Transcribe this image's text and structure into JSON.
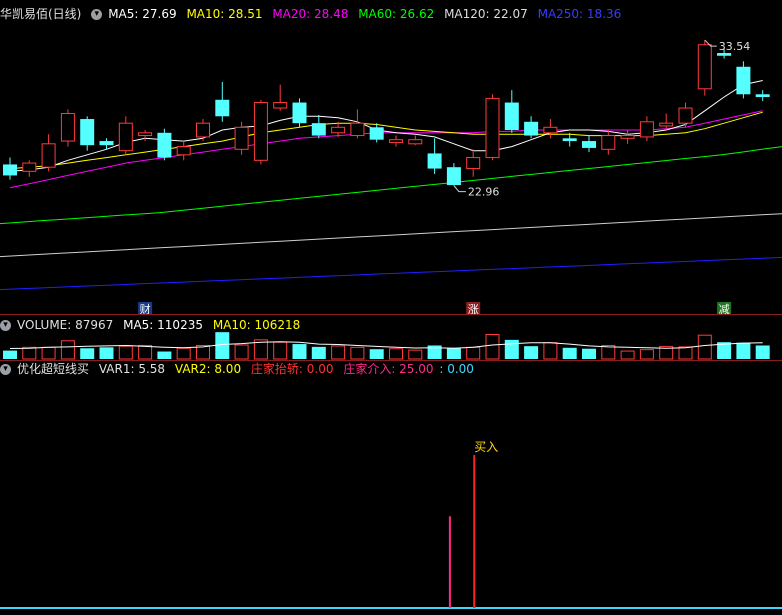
{
  "main_header": {
    "stock": "华凯易佰(日线)",
    "ma5": "MA5: 27.69",
    "ma10": "MA10: 28.51",
    "ma20": "MA20: 28.48",
    "ma60": "MA60: 26.62",
    "ma120": "MA120: 22.07",
    "ma250": "MA250: 18.36"
  },
  "vol_header": {
    "volume": "VOLUME: 87967",
    "ma5": "MA5: 110235",
    "ma10": "MA10: 106218"
  },
  "ind_header": {
    "name": "优化超短线买",
    "var1": "VAR1: 5.58",
    "var2": "VAR2: 8.00",
    "zjcl": "庄家抬轿: 0.00",
    "zjjr": "庄家介入: 25.00",
    "tail": ": 0.00"
  },
  "colors": {
    "up": "#ff3b3b",
    "down": "#54ffff",
    "ma5": "#ffffff",
    "ma10": "#ffff00",
    "ma20": "#ff00ff",
    "ma60": "#00ff00",
    "ma120": "#cfcfcf",
    "ma250": "#2020ff",
    "signal_pink": "#ff2a8a",
    "signal_red": "#ff2020",
    "baseline": "#3fd6ff"
  },
  "chart_data": {
    "type": "candlestick",
    "price_high_label": "33.54",
    "price_low_label": "22.96",
    "markers": [
      {
        "text": "财",
        "candle": 7
      },
      {
        "text": "涨",
        "candle": 24
      },
      {
        "text": "减",
        "candle": 37
      }
    ],
    "buy_label": "买入",
    "candles": [
      {
        "o": 24.5,
        "c": 23.7,
        "h": 25.0,
        "l": 23.4
      },
      {
        "o": 24.0,
        "c": 24.6,
        "h": 24.8,
        "l": 23.6
      },
      {
        "o": 24.3,
        "c": 26.0,
        "h": 26.7,
        "l": 24.0
      },
      {
        "o": 26.2,
        "c": 28.2,
        "h": 28.5,
        "l": 25.8
      },
      {
        "o": 27.8,
        "c": 25.9,
        "h": 28.0,
        "l": 25.5
      },
      {
        "o": 26.2,
        "c": 25.9,
        "h": 26.4,
        "l": 25.6
      },
      {
        "o": 25.5,
        "c": 27.5,
        "h": 28.0,
        "l": 25.2
      },
      {
        "o": 26.6,
        "c": 26.8,
        "h": 27.0,
        "l": 26.2
      },
      {
        "o": 26.8,
        "c": 25.0,
        "h": 27.1,
        "l": 24.8
      },
      {
        "o": 25.2,
        "c": 25.8,
        "h": 26.2,
        "l": 24.8
      },
      {
        "o": 26.5,
        "c": 27.5,
        "h": 27.8,
        "l": 26.2
      },
      {
        "o": 29.2,
        "c": 28.0,
        "h": 30.5,
        "l": 27.6
      },
      {
        "o": 25.6,
        "c": 27.2,
        "h": 27.6,
        "l": 25.2
      },
      {
        "o": 24.8,
        "c": 29.0,
        "h": 29.2,
        "l": 24.5
      },
      {
        "o": 28.6,
        "c": 29.0,
        "h": 30.3,
        "l": 28.4
      },
      {
        "o": 29.0,
        "c": 27.5,
        "h": 29.3,
        "l": 27.2
      },
      {
        "o": 27.5,
        "c": 26.6,
        "h": 28.1,
        "l": 26.4
      },
      {
        "o": 26.8,
        "c": 27.2,
        "h": 27.6,
        "l": 26.5
      },
      {
        "o": 26.6,
        "c": 27.5,
        "h": 28.5,
        "l": 26.4
      },
      {
        "o": 27.2,
        "c": 26.3,
        "h": 27.5,
        "l": 26.1
      },
      {
        "o": 26.1,
        "c": 26.3,
        "h": 26.6,
        "l": 25.8
      },
      {
        "o": 26.0,
        "c": 26.3,
        "h": 26.6,
        "l": 25.9
      },
      {
        "o": 25.3,
        "c": 24.2,
        "h": 26.4,
        "l": 23.8
      },
      {
        "o": 24.3,
        "c": 23.0,
        "h": 24.6,
        "l": 22.96
      },
      {
        "o": 24.2,
        "c": 25.0,
        "h": 25.6,
        "l": 23.6
      },
      {
        "o": 25.0,
        "c": 29.3,
        "h": 29.6,
        "l": 24.8
      },
      {
        "o": 29.0,
        "c": 27.0,
        "h": 29.9,
        "l": 26.8
      },
      {
        "o": 27.6,
        "c": 26.6,
        "h": 28.0,
        "l": 26.4
      },
      {
        "o": 26.8,
        "c": 27.2,
        "h": 27.8,
        "l": 26.4
      },
      {
        "o": 26.4,
        "c": 26.2,
        "h": 26.8,
        "l": 25.8
      },
      {
        "o": 26.2,
        "c": 25.7,
        "h": 26.6,
        "l": 25.4
      },
      {
        "o": 25.6,
        "c": 26.6,
        "h": 27.0,
        "l": 25.2
      },
      {
        "o": 26.4,
        "c": 26.6,
        "h": 27.0,
        "l": 26.0
      },
      {
        "o": 26.5,
        "c": 27.6,
        "h": 28.0,
        "l": 26.2
      },
      {
        "o": 27.3,
        "c": 27.5,
        "h": 28.2,
        "l": 27.0
      },
      {
        "o": 27.5,
        "c": 28.6,
        "h": 29.0,
        "l": 27.2
      },
      {
        "o": 30.0,
        "c": 33.2,
        "h": 33.54,
        "l": 29.5
      },
      {
        "o": 32.6,
        "c": 32.4,
        "h": 32.9,
        "l": 32.2
      },
      {
        "o": 31.6,
        "c": 29.6,
        "h": 32.0,
        "l": 29.3
      },
      {
        "o": 29.6,
        "c": 29.4,
        "h": 29.9,
        "l": 29.1
      }
    ],
    "volumes": [
      0.36,
      0.5,
      0.5,
      0.78,
      0.46,
      0.5,
      0.55,
      0.58,
      0.32,
      0.46,
      0.58,
      1.15,
      0.6,
      0.82,
      0.72,
      0.64,
      0.52,
      0.56,
      0.5,
      0.42,
      0.44,
      0.38,
      0.58,
      0.48,
      0.5,
      1.05,
      0.82,
      0.55,
      0.7,
      0.48,
      0.44,
      0.58,
      0.34,
      0.4,
      0.54,
      0.52,
      1.02,
      0.72,
      0.7,
      0.58
    ],
    "vol_ma5": [
      0.45,
      0.46,
      0.5,
      0.52,
      0.55,
      0.56,
      0.58,
      0.54,
      0.5,
      0.48,
      0.52,
      0.62,
      0.66,
      0.72,
      0.74,
      0.72,
      0.64,
      0.62,
      0.58,
      0.54,
      0.5,
      0.47,
      0.48,
      0.46,
      0.5,
      0.6,
      0.65,
      0.7,
      0.7,
      0.64,
      0.56,
      0.52,
      0.5,
      0.48,
      0.46,
      0.48,
      0.58,
      0.64,
      0.68,
      0.7
    ],
    "ma5": [
      24.0,
      24.1,
      24.3,
      24.8,
      25.2,
      25.6,
      26.1,
      26.4,
      26.3,
      26.2,
      26.4,
      27.0,
      27.2,
      27.3,
      27.7,
      28.0,
      28.0,
      27.9,
      27.6,
      27.0,
      26.8,
      26.7,
      26.5,
      26.0,
      25.5,
      25.5,
      25.8,
      26.3,
      26.8,
      27.0,
      27.0,
      26.9,
      26.7,
      26.8,
      27.0,
      27.4,
      28.4,
      29.4,
      30.3,
      30.6
    ],
    "ma10": [
      24.2,
      24.3,
      24.4,
      24.6,
      24.8,
      25.0,
      25.2,
      25.4,
      25.6,
      25.8,
      26.0,
      26.2,
      26.5,
      26.8,
      27.0,
      27.2,
      27.4,
      27.5,
      27.5,
      27.4,
      27.2,
      27.0,
      26.9,
      26.8,
      26.7,
      26.7,
      26.7,
      26.7,
      26.7,
      26.7,
      26.6,
      26.6,
      26.6,
      26.6,
      26.7,
      26.8,
      27.1,
      27.5,
      27.9,
      28.3
    ],
    "ma20": [
      22.8,
      23.1,
      23.4,
      23.7,
      24.0,
      24.3,
      24.6,
      24.8,
      25.0,
      25.2,
      25.4,
      25.6,
      25.8,
      26.0,
      26.2,
      26.4,
      26.5,
      26.6,
      26.7,
      26.8,
      26.8,
      26.8,
      26.8,
      26.8,
      26.8,
      26.9,
      26.9,
      27.0,
      27.0,
      27.0,
      27.0,
      27.0,
      27.0,
      27.0,
      27.1,
      27.2,
      27.5,
      27.8,
      28.1,
      28.4
    ],
    "ma60": [
      20.2,
      20.3,
      20.4,
      20.5,
      20.6,
      20.7,
      20.8,
      20.9,
      21.0,
      21.15,
      21.3,
      21.45,
      21.6,
      21.75,
      21.9,
      22.05,
      22.2,
      22.35,
      22.5,
      22.65,
      22.8,
      22.95,
      23.1,
      23.25,
      23.4,
      23.55,
      23.7,
      23.85,
      24.0,
      24.15,
      24.3,
      24.45,
      24.6,
      24.75,
      24.9,
      25.05,
      25.2,
      25.4,
      25.6,
      25.8
    ],
    "ma120": [
      17.8,
      17.88,
      17.96,
      18.04,
      18.12,
      18.2,
      18.28,
      18.36,
      18.44,
      18.52,
      18.6,
      18.68,
      18.76,
      18.84,
      18.92,
      19.0,
      19.08,
      19.16,
      19.24,
      19.32,
      19.4,
      19.48,
      19.56,
      19.64,
      19.72,
      19.8,
      19.88,
      19.96,
      20.04,
      20.12,
      20.2,
      20.28,
      20.36,
      20.44,
      20.52,
      20.6,
      20.68,
      20.76,
      20.84,
      20.92
    ],
    "ma250": [
      15.4,
      15.46,
      15.52,
      15.58,
      15.64,
      15.7,
      15.76,
      15.82,
      15.88,
      15.94,
      16.0,
      16.06,
      16.12,
      16.18,
      16.24,
      16.3,
      16.36,
      16.42,
      16.48,
      16.54,
      16.6,
      16.66,
      16.72,
      16.78,
      16.84,
      16.9,
      16.96,
      17.02,
      17.08,
      17.14,
      17.2,
      17.26,
      17.32,
      17.38,
      17.44,
      17.5,
      17.56,
      17.62,
      17.68,
      17.74
    ],
    "signals": [
      {
        "candle": 23,
        "value": 15,
        "kind": "pink"
      },
      {
        "candle": 24,
        "value": 25,
        "kind": "red"
      }
    ]
  }
}
